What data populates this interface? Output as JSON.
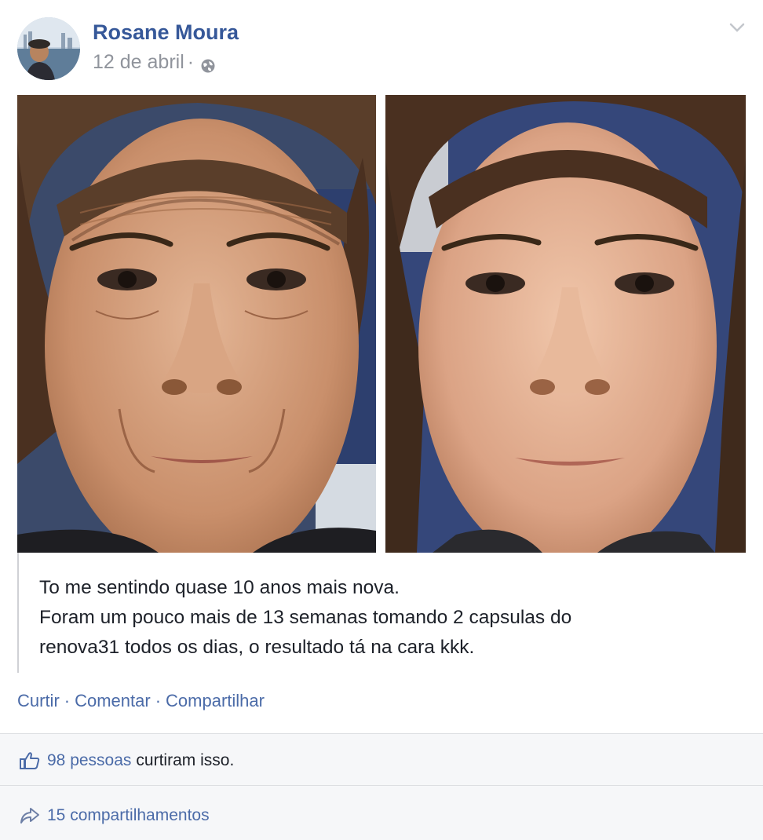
{
  "post": {
    "author": "Rosane Moura",
    "date": "12 de abril",
    "separator": "·",
    "privacy_icon": "globe-icon",
    "menu_icon": "chevron-down-icon",
    "caption_lines": [
      "To me sentindo quase 10 anos mais nova.",
      "Foram um pouco mais de 13 semanas tomando 2 capsulas do",
      "renova31 todos os dias, o resultado tá na cara kkk."
    ]
  },
  "actions": {
    "like": "Curtir",
    "comment": "Comentar",
    "share": "Compartilhar",
    "separator": "·"
  },
  "reactions": {
    "like_icon": "thumbs-up-icon",
    "likes_count": "98 pessoas",
    "likes_text": "curtiram isso.",
    "share_icon": "share-arrow-icon",
    "shares_text": "15 compartilhamentos"
  },
  "colors": {
    "link": "#365899",
    "action_link": "#4b6ba8",
    "meta": "#90949c",
    "text": "#1d2129",
    "footer_bg": "#f6f7f9"
  }
}
